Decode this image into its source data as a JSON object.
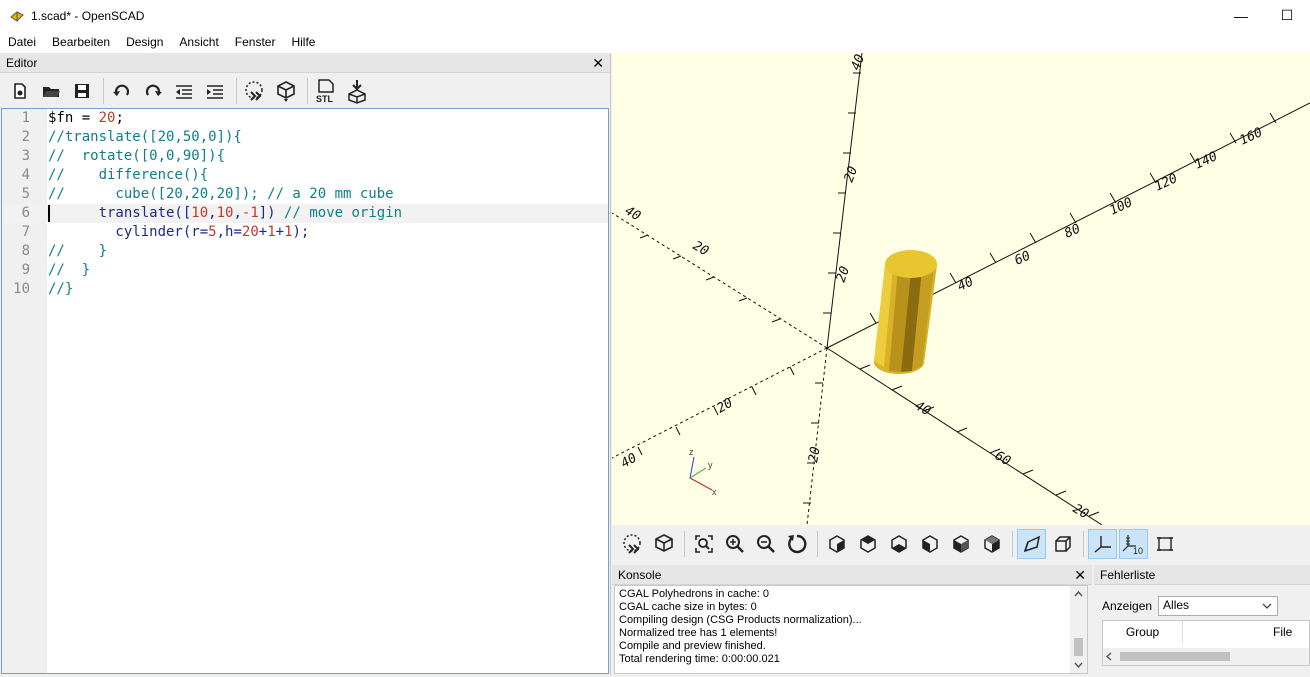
{
  "window": {
    "title": "1.scad* - OpenSCAD",
    "minimize": "—",
    "maximize": "☐"
  },
  "menu": [
    "Datei",
    "Bearbeiten",
    "Design",
    "Ansicht",
    "Fenster",
    "Hilfe"
  ],
  "editor": {
    "title": "Editor",
    "close": "✕",
    "toolbar": [
      "new-file-icon",
      "open-file-icon",
      "save-icon",
      "undo-icon",
      "redo-icon",
      "unindent-icon",
      "indent-icon",
      "preview-icon",
      "render-icon",
      "export-stl-icon",
      "send-to-print-icon"
    ],
    "stl_label": "STL",
    "lines": [
      {
        "n": "1",
        "text": "$fn = 20;"
      },
      {
        "n": "2",
        "text": "//translate([20,50,0]){"
      },
      {
        "n": "3",
        "text": "//  rotate([0,0,90]){"
      },
      {
        "n": "4",
        "text": "//    difference(){"
      },
      {
        "n": "5",
        "text": "//      cube([20,20,20]); // a 20 mm cube"
      },
      {
        "n": "6",
        "text": "      translate([10,10,-1]) // move origin"
      },
      {
        "n": "7",
        "text": "        cylinder(r=5,h=20+1+1);"
      },
      {
        "n": "8",
        "text": "//    }"
      },
      {
        "n": "9",
        "text": "//  }"
      },
      {
        "n": "10",
        "text": "//}"
      }
    ]
  },
  "viewport": {
    "axis_labels": [
      "40",
      "20",
      "20",
      "40",
      "60",
      "20",
      "40",
      "60",
      "80",
      "100",
      "120",
      "140",
      "160",
      "40",
      "20",
      "20",
      "40",
      "20"
    ],
    "axis_gizmo": {
      "x": "x",
      "y": "y",
      "z": "z"
    },
    "background_color": "#ffffe5",
    "object_color": "#f3d23a",
    "toolbar": [
      "preview-icon",
      "render-icon",
      "view-all-icon",
      "zoom-in-icon",
      "zoom-out-icon",
      "reset-view-icon",
      "view-right-icon",
      "view-top-icon",
      "view-bottom-icon",
      "view-left-icon",
      "view-front-icon",
      "view-back-icon",
      "perspective-icon",
      "orthogonal-icon",
      "show-axes-icon",
      "show-scale-icon",
      "show-edges-icon"
    ],
    "scale_label": "10"
  },
  "console": {
    "title": "Konsole",
    "close": "✕",
    "lines": [
      "CGAL Polyhedrons in cache: 0",
      "CGAL cache size in bytes: 0",
      "Compiling design (CSG Products normalization)...",
      "Normalized tree has 1 elements!",
      "Compile and preview finished.",
      "Total rendering time: 0:00:00.021"
    ]
  },
  "errors": {
    "title": "Fehlerliste",
    "filter_label": "Anzeigen",
    "filter_value": "Alles",
    "columns": [
      "Group",
      "File"
    ]
  }
}
